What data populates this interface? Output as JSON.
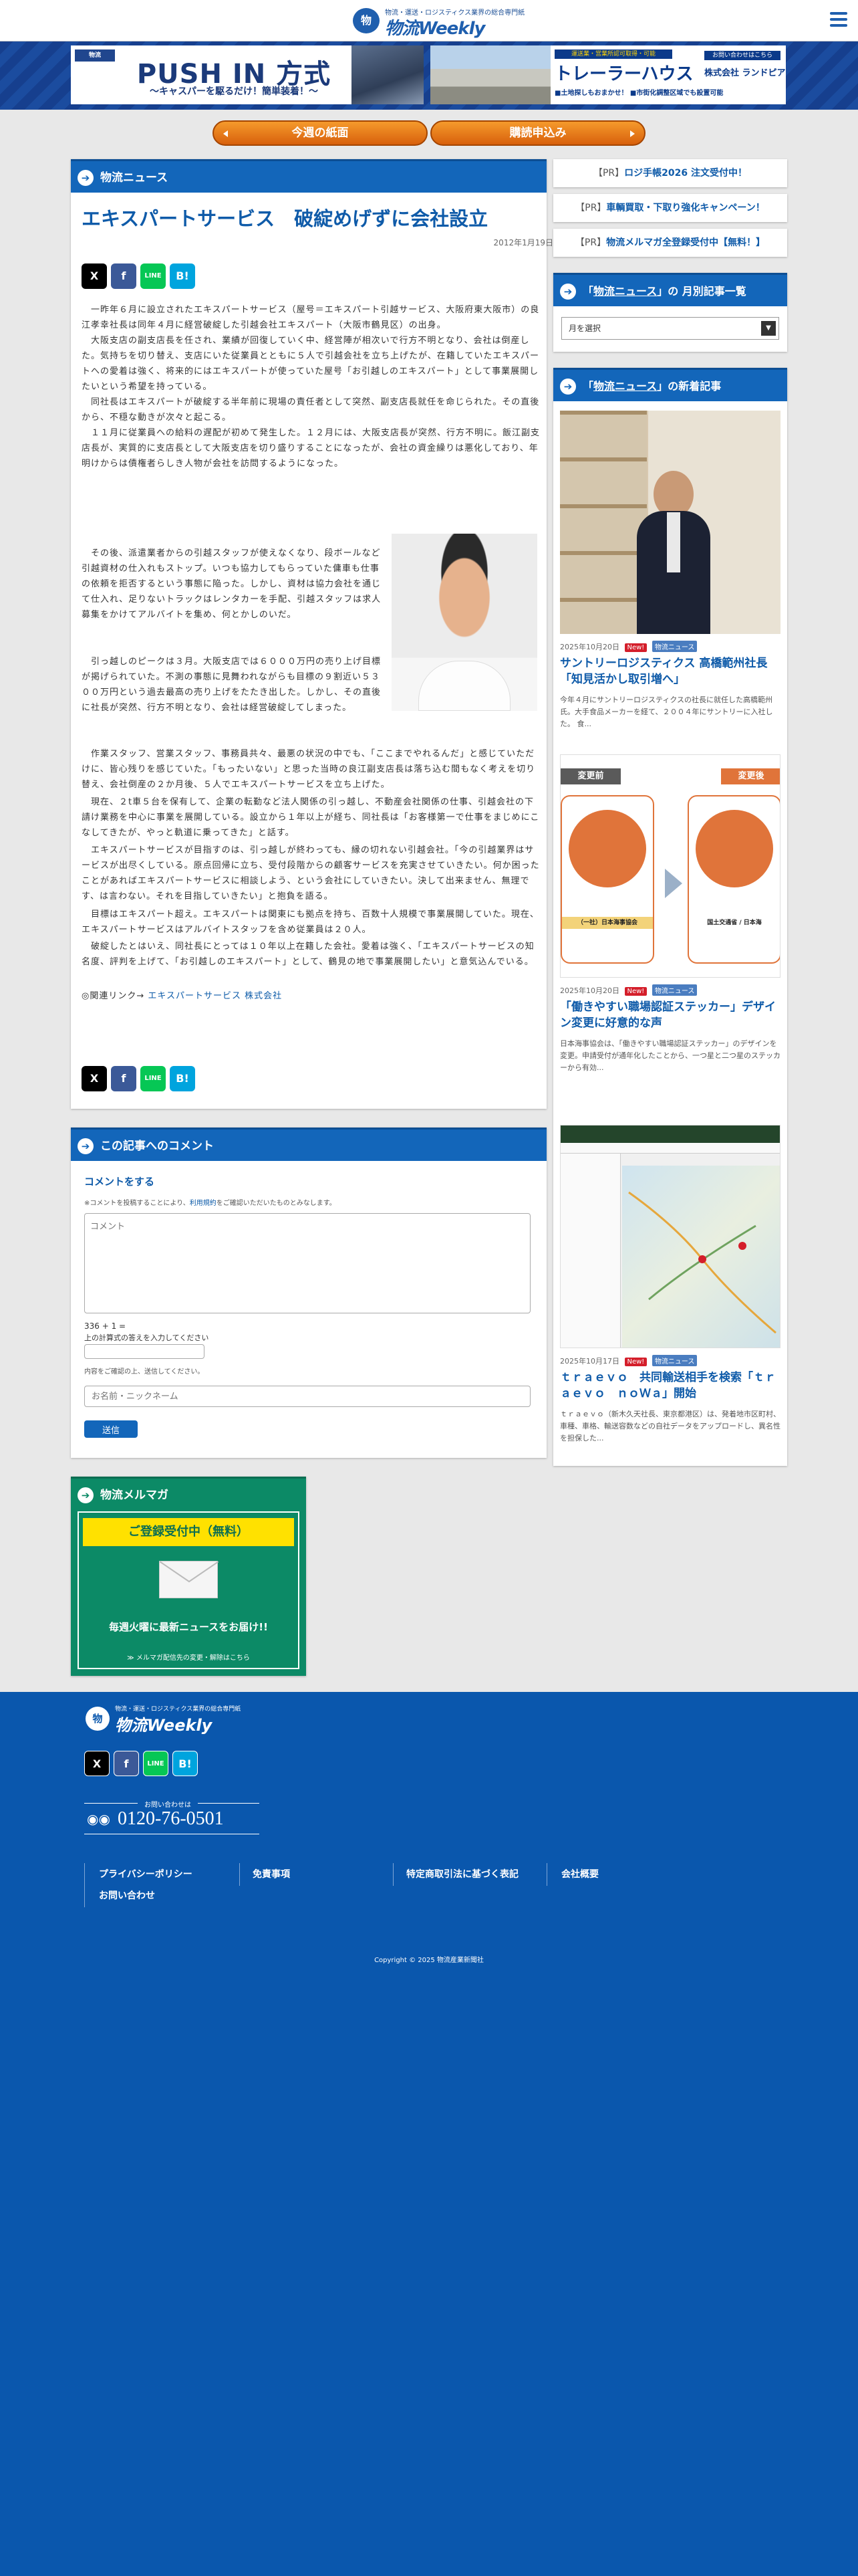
{
  "header": {
    "tagline": "物流・運送・ロジスティクス業界の総合専門紙",
    "logo_mark": "物",
    "logo_name": "物流Weekly"
  },
  "banners": {
    "ad1": {
      "brand": "物流",
      "title": "PUSH IN 方式",
      "subtitle": "〜キャスパーを駆るだけ！簡単装着！〜"
    },
    "ad2": {
      "label": "運送業・営業所認可取得・可能",
      "title": "トレーラーハウス",
      "sub": "■土地探しもおまかせ！ ■市街化調整区域でも設置可能",
      "contact": "お問い合わせはこちら",
      "company": "株式会社 ランドピア"
    }
  },
  "nav": {
    "current_issue": "今週の紙面",
    "subscribe": "購読申込み"
  },
  "article": {
    "section": "物流ニュース",
    "title": "エキスパートサービス　破綻めげずに会社設立",
    "date": "2012年1月19日",
    "p1": "　一昨年６月に設立されたエキスパートサービス（屋号＝エキスパート引越サービス、大阪府東大阪市）の良江孝幸社長は同年４月に経営破綻した引越会社エキスパート（大阪市鶴見区）の出身。",
    "p2": "　大阪支店の副支店長を任され、業績が回復していく中、経営陣が相次いで行方不明となり、会社は倒産した。気持ちを切り替え、支店にいた従業員とともに５人で引越会社を立ち上げたが、在籍していたエキスパートへの愛着は強く、将来的にはエキスパートが使っていた屋号「お引越しのエキスパート」として事業展開したいという希望を持っている。",
    "p3": "　同社長はエキスパートが破綻する半年前に現場の責任者として突然、副支店長就任を命じられた。その直後から、不穏な動きが次々と起こる。",
    "p4": "　１１月に従業員への給料の遅配が初めて発生した。１２月には、大阪支店長が突然、行方不明に。飯江副支店長が、実質的に支店長として大阪支店を切り盛りすることになったが、会社の資金繰りは悪化しており、年明けからは債権者らしき人物が会社を訪問するようになった。",
    "p5": "　その後、派遣業者からの引越スタッフが使えなくなり、段ボールなど引越資材の仕入れもストップ。いつも協力してもらっていた傭車も仕事の依頼を拒否するという事態に陥った。しかし、資材は協力会社を通じて仕入れ、足りないトラックはレンタカーを手配、引越スタッフは求人募集をかけてアルバイトを集め、何とかしのいだ。",
    "p6": "　引っ越しのピークは３月。大阪支店では６０００万円の売り上げ目標が掲げられていた。不測の事態に見舞われながらも目標の９割近い５３００万円という過去最高の売り上げをたたき出した。しかし、その直後に社長が突然、行方不明となり、会社は経営破綻してしまった。",
    "p7": "　作業スタッフ、営業スタッフ、事務員共々、最悪の状況の中でも、「ここまでやれるんだ」と感じていただけに、皆心残りを感じていた。「もったいない」と思った当時の良江副支店長は落ち込む間もなく考えを切り替え、会社倒産の２か月後、５人でエキスパートサービスを立ち上げた。",
    "p8": "　現在、２t車５台を保有して、企業の転勤など法人関係の引っ越し、不動産会社関係の仕事、引越会社の下請け業務を中心に事業を展開している。設立から１年以上が経ち、同社長は「お客様第一で仕事をまじめにこなしてきたが、やっと軌道に乗ってきた」と話す。",
    "p9": "　エキスパートサービスが目指すのは、引っ越しが終わっても、縁の切れない引越会社。「今の引越業界はサービスが出尽くしている。原点回帰に立ち、受付段階からの顧客サービスを充実させていきたい。何か困ったことがあればエキスパートサービスに相談しよう、という会社にしていきたい。決して出来ません、無理です、は言わない。それを目指していきたい」と抱負を語る。",
    "p10": "　目標はエキスパート超え。エキスパートは関東にも拠点を持ち、百数十人規模で事業展開していた。現在、エキスパートサービスはアルバイトスタッフを含め従業員は２０人。",
    "p11": "　破綻したとはいえ、同社長にとっては１０年以上在籍した会社。愛着は強く、「エキスパートサービスの知名度、評判を上げて、「お引越しのエキスパート」として、鶴見の地で事業展開したい」と意気込んでいる。",
    "related_prefix": "◎関連リンク→",
    "related_link": "エキスパートサービス 株式会社"
  },
  "share": {
    "x": "X",
    "facebook": "f",
    "line": "LINE",
    "hatena": "B!"
  },
  "comment": {
    "section": "この記事へのコメント",
    "heading": "コメントをする",
    "note_prefix": "※コメントを投稿することにより、",
    "note_link": "利用規約",
    "note_suffix": "をご確認いただいたものとみなします。",
    "textarea_placeholder": "コメント",
    "captcha": "336 + 1 =",
    "captcha_hint": "上の計算式の答えを入力してください",
    "confirm": "内容をご確認の上、送信してください。",
    "name_placeholder": "お名前・ニックネーム",
    "submit": "送信"
  },
  "sidebar": {
    "pr1": "ロジ手帳2026 注文受付中！",
    "pr2": "車輌買取・下取り強化キャンペーン！",
    "pr3": "物流メルマガ全登録受付中【無料！】",
    "pr_prefix": "【PR】",
    "monthly_title_a": "「",
    "monthly_title_q": "物流ニュース",
    "monthly_title_b": "」の 月別記事一覧",
    "month_select": "月を選択",
    "new_title_a": "「",
    "new_title_q": "物流ニュース",
    "new_title_b": "」の新着記事",
    "news": [
      {
        "date": "2025年10月20日",
        "new": "New!",
        "cat": "物流ニュース",
        "title": "サントリーロジスティクス 高橋範州社長「知見活かし取引増へ」",
        "excerpt": "今年４月にサントリーロジスティクスの社長に就任した高橋範州氏。大手食品メーカーを経て、２００４年にサントリーに入社した。 食..."
      },
      {
        "date": "2025年10月20日",
        "new": "New!",
        "cat": "物流ニュース",
        "title": "「働きやすい職場認証ステッカー」デザイン変更に好意的な声",
        "excerpt": "日本海事協会は、「働きやすい職場認証ステッカー」のデザインを変更。申請受付が通年化したことから、一つ星と二つ星のステッカーから有効...",
        "before": "変更前",
        "after": "変更後",
        "assoc1": "（一社）日本海事協会",
        "assoc2": "国土交通省 / 日本海"
      },
      {
        "date": "2025年10月17日",
        "new": "New!",
        "cat": "物流ニュース",
        "title": "ｔｒａｅｖｏ　共同輸送相手を検索「ｔｒａｅｖｏ　ｎｏＷａ」開始",
        "excerpt": "ｔｒａｅｖｏ（新木久天社長、東京都港区）は、発着地市区町村、車種、車格、輸送容数などの自社データをアップロードし、異名性を担保した..."
      }
    ]
  },
  "mailmag": {
    "section": "物流メルマガ",
    "cta": "ご登録受付中（無料）",
    "tagline": "毎週火曜に最新ニュースをお届け!!",
    "change": "≫ メルマガ配信先の変更・解除はこちら"
  },
  "footer": {
    "tagline": "物流・運送・ロジスティクス業界の総合専門紙",
    "logo_name": "物流Weekly",
    "contact_label": "お問い合わせは",
    "phone": "0120-76-0501",
    "links": [
      "プライバシーポリシー",
      "免責事項",
      "特定商取引法に基づく表記",
      "会社概要",
      "お問い合わせ"
    ],
    "copyright": "Copyright © 2025 物流産業新聞社"
  },
  "colors": {
    "brand_blue": "#1366ba",
    "footer_blue": "#0a57ad",
    "nav_orange": "#e8761a",
    "mailmag_green": "#0c8a66",
    "new_red": "#d41e2a",
    "cta_yellow": "#ffe100"
  }
}
